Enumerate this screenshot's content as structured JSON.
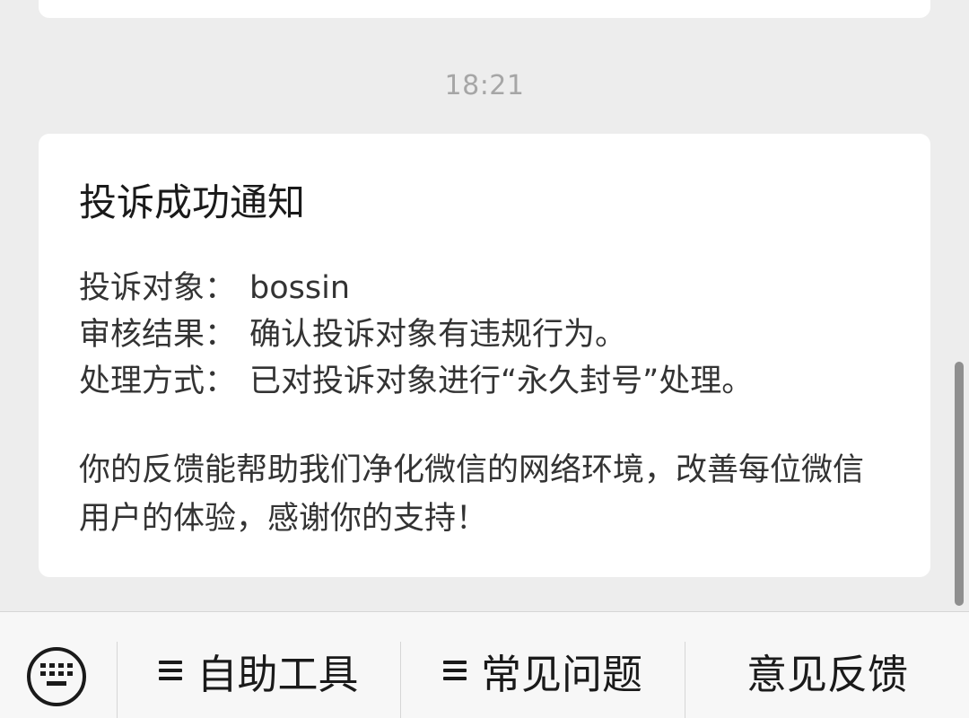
{
  "chat": {
    "timestamp": "18:21"
  },
  "notice": {
    "title": "投诉成功通知",
    "details": [
      {
        "label": "投诉对象：",
        "value": "bossin"
      },
      {
        "label": "审核结果：",
        "value": "确认投诉对象有违规行为。"
      },
      {
        "label": "处理方式：",
        "value": "已对投诉对象进行“永久封号”处理。"
      }
    ],
    "message": "你的反馈能帮助我们净化微信的网络环境，改善每位微信用户的体验，感谢你的支持！"
  },
  "bottom_menu": {
    "keyboard_icon": "keyboard-icon",
    "items": [
      {
        "label": "自助工具",
        "icon": "menu-list-icon"
      },
      {
        "label": "常见问题",
        "icon": "menu-list-icon"
      },
      {
        "label": "意见反馈"
      }
    ]
  }
}
